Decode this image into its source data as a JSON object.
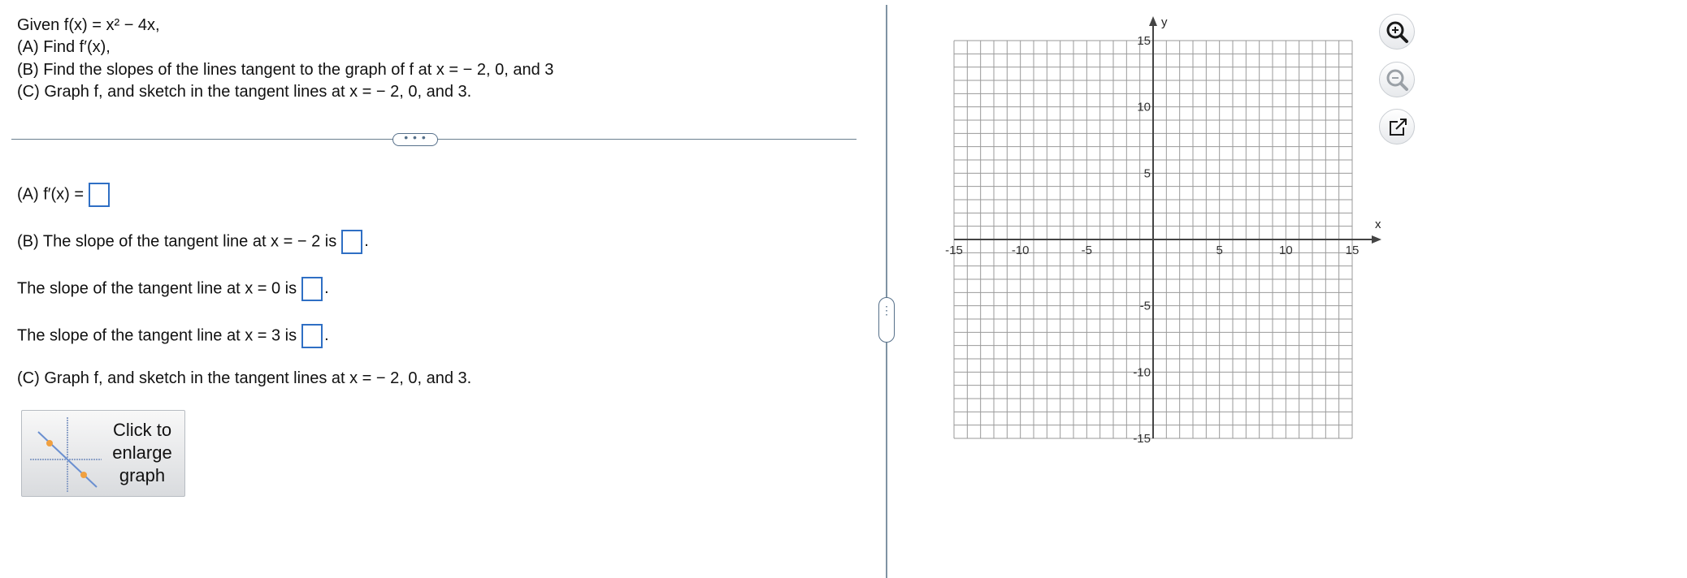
{
  "problem": {
    "given": "Given f(x) = x² − 4x,",
    "part_a": "(A)  Find f′(x),",
    "part_b": "(B)  Find the slopes of the lines tangent to the graph of f at x = − 2, 0, and 3",
    "part_c": "(C)  Graph f, and sketch in the tangent lines at x = − 2, 0, and 3."
  },
  "more_label": "• • •",
  "answers": {
    "a_label": "(A)  f′(x) =",
    "b_label": "(B)  The slope of the tangent line at x = − 2 is",
    "slope_0_label": "The slope of the tangent line at x = 0 is",
    "slope_3_label": "The slope of the tangent line at x = 3 is",
    "period": ".",
    "c_label": "(C)  Graph f, and sketch in the tangent lines at x = − 2, 0, and 3."
  },
  "enlarge_button": {
    "line1": "Click to",
    "line2": "enlarge",
    "line3": "graph"
  },
  "handle_label": "⋮",
  "graph": {
    "x_axis_label": "x",
    "y_axis_label": "y",
    "x_range": [
      -15,
      15
    ],
    "y_range": [
      -15,
      15
    ],
    "x_tick_labels": [
      "-15",
      "-10",
      "-5",
      "5",
      "10",
      "15"
    ],
    "y_tick_labels": [
      "15",
      "10",
      "5",
      "-5",
      "-10",
      "-15"
    ],
    "grid": true,
    "grid_step": 1
  },
  "tools": {
    "zoom_in_icon": "zoom-in-icon",
    "zoom_out_icon": "zoom-out-icon",
    "popout_icon": "external-link-icon"
  },
  "colors": {
    "answer_box_border": "#2f6fc4",
    "grid_line": "#9a9a9a",
    "axis": "#444444"
  }
}
